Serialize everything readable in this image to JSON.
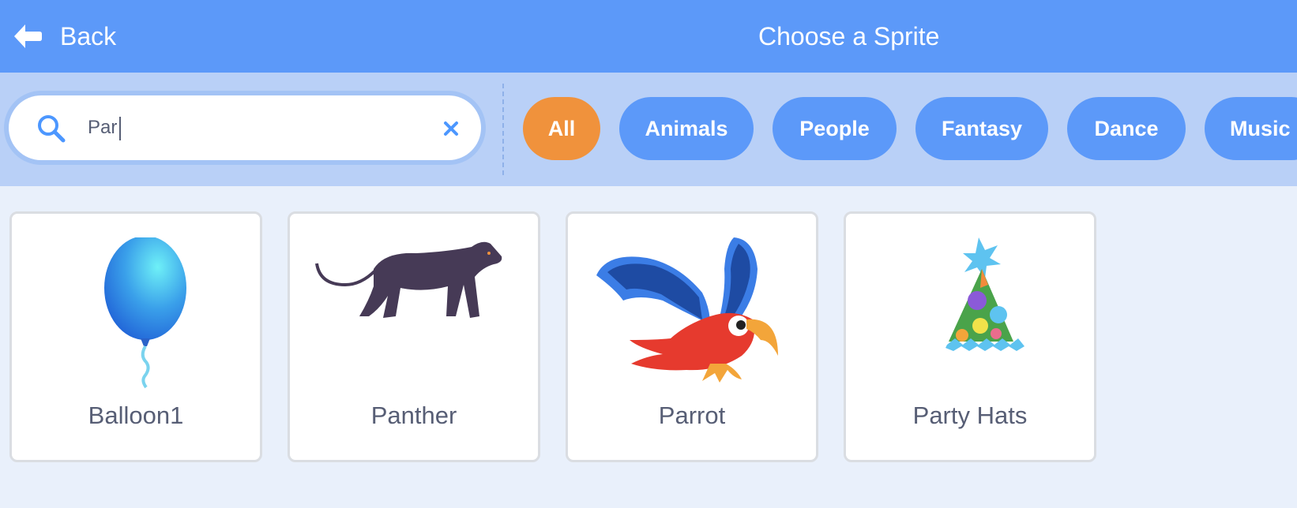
{
  "header": {
    "back_label": "Back",
    "title": "Choose a Sprite"
  },
  "search": {
    "value": "Par",
    "placeholder": ""
  },
  "filters": [
    {
      "label": "All",
      "active": true
    },
    {
      "label": "Animals",
      "active": false
    },
    {
      "label": "People",
      "active": false
    },
    {
      "label": "Fantasy",
      "active": false
    },
    {
      "label": "Dance",
      "active": false
    },
    {
      "label": "Music",
      "active": false
    }
  ],
  "sprites": [
    {
      "name": "Balloon1",
      "icon": "balloon-icon"
    },
    {
      "name": "Panther",
      "icon": "panther-icon"
    },
    {
      "name": "Parrot",
      "icon": "parrot-icon"
    },
    {
      "name": "Party Hats",
      "icon": "party-hat-icon"
    }
  ],
  "colors": {
    "header": "#5c99f9",
    "filter_bar": "#b9d0f7",
    "active_pill": "#f0923c",
    "pill": "#5c99f9",
    "text": "#575e75"
  }
}
